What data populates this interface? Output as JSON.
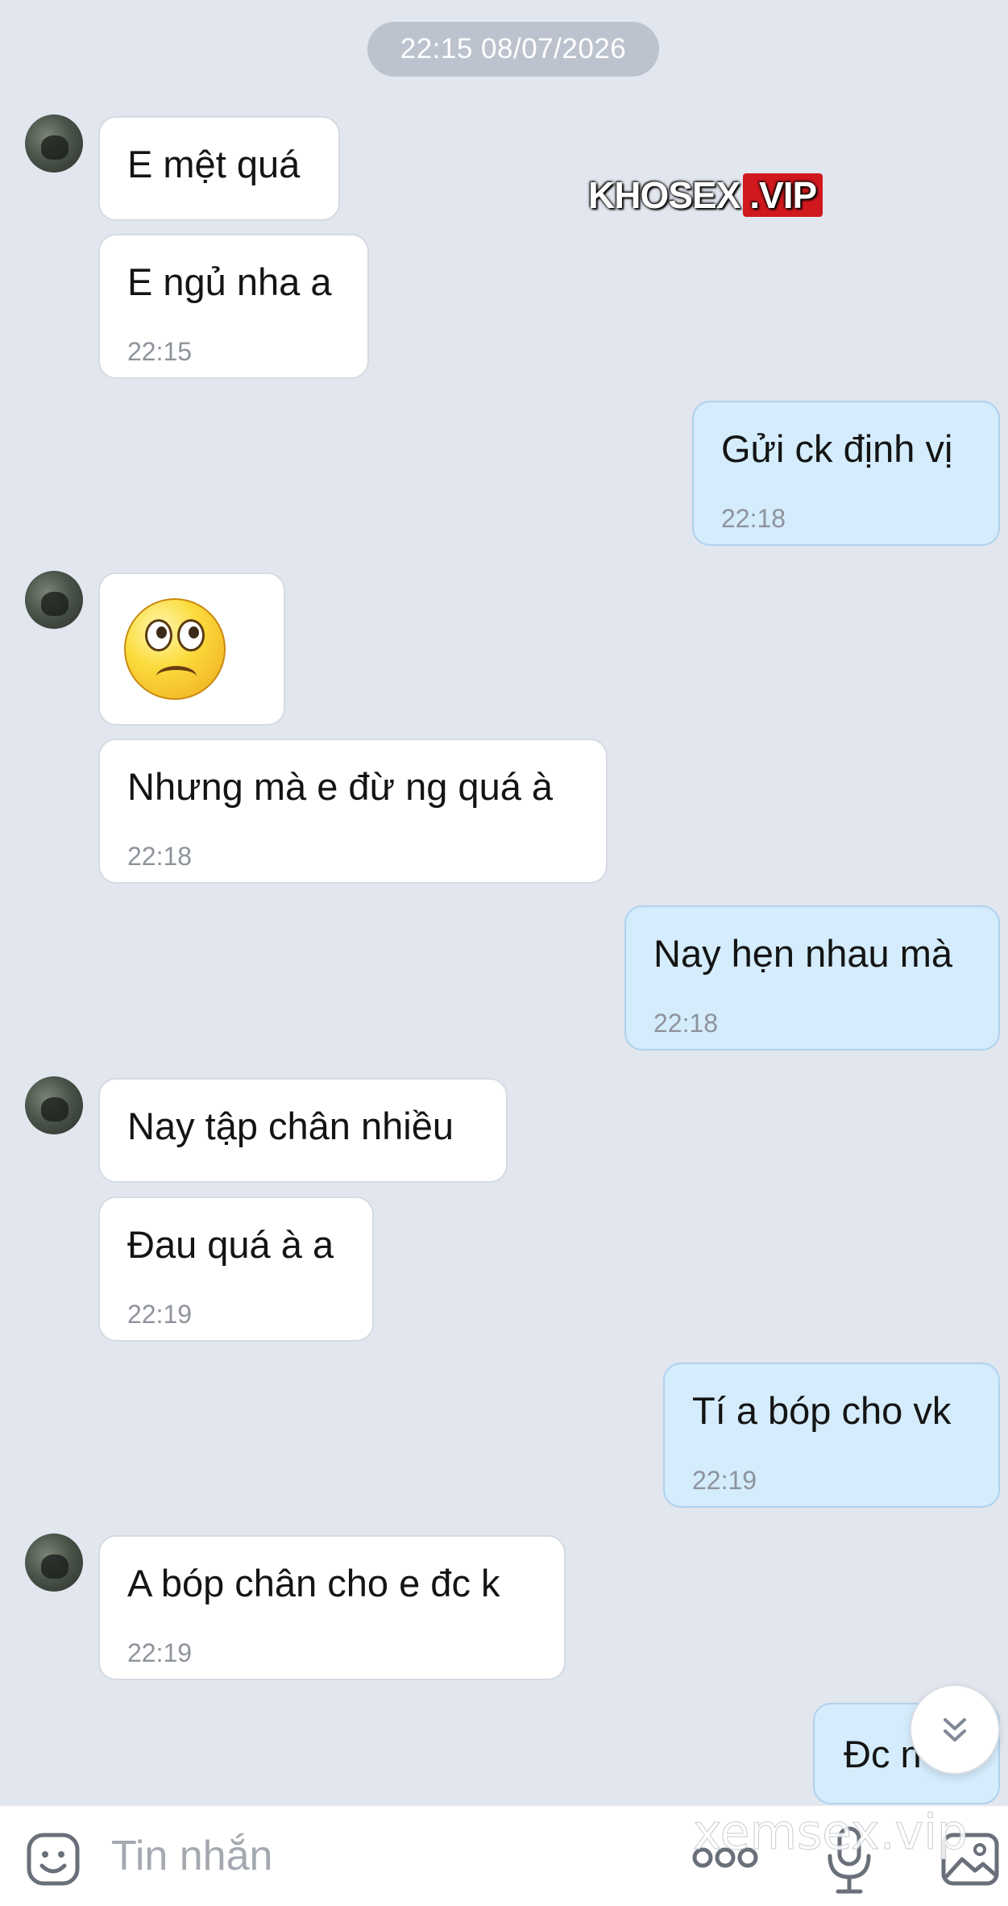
{
  "chat": {
    "date_separator": "22:15 08/07/2026",
    "messages": [
      {
        "side": "in",
        "text": "E mệt quá",
        "time": ""
      },
      {
        "side": "in",
        "text": "E ngủ nha a",
        "time": "22:15"
      },
      {
        "side": "out",
        "text": "Gửi ck định vị",
        "time": "22:18"
      },
      {
        "side": "in",
        "type": "sticker",
        "sticker": "frown-emoji"
      },
      {
        "side": "in",
        "text": "Nhưng mà e đừ ng quá à",
        "time": "22:18"
      },
      {
        "side": "out",
        "text": "Nay hẹn nhau mà",
        "time": "22:18"
      },
      {
        "side": "in",
        "text": "Nay tập chân nhiều",
        "time": ""
      },
      {
        "side": "in",
        "text": "Đau quá à a",
        "time": "22:19"
      },
      {
        "side": "out",
        "text": "Tí a bóp cho vk",
        "time": "22:19"
      },
      {
        "side": "in",
        "text": "A bóp chân cho e đc k",
        "time": "22:19"
      },
      {
        "side": "out",
        "text": "Đc n",
        "time": ""
      }
    ]
  },
  "watermark": {
    "brand": "KHOSEX",
    "suffix": ".VIP"
  },
  "watermark_bottom": "xemsex.vip",
  "input_bar": {
    "placeholder": "Tin nhắn",
    "icons": [
      "emoji-icon",
      "more-icon",
      "microphone-icon",
      "image-icon"
    ]
  },
  "scroll_button": {
    "icon": "double-chevron-down-icon"
  },
  "colors": {
    "background": "#e2e6ee",
    "incoming": "#ffffff",
    "outgoing": "#d4ecfc",
    "accent": "#1a8cff"
  }
}
